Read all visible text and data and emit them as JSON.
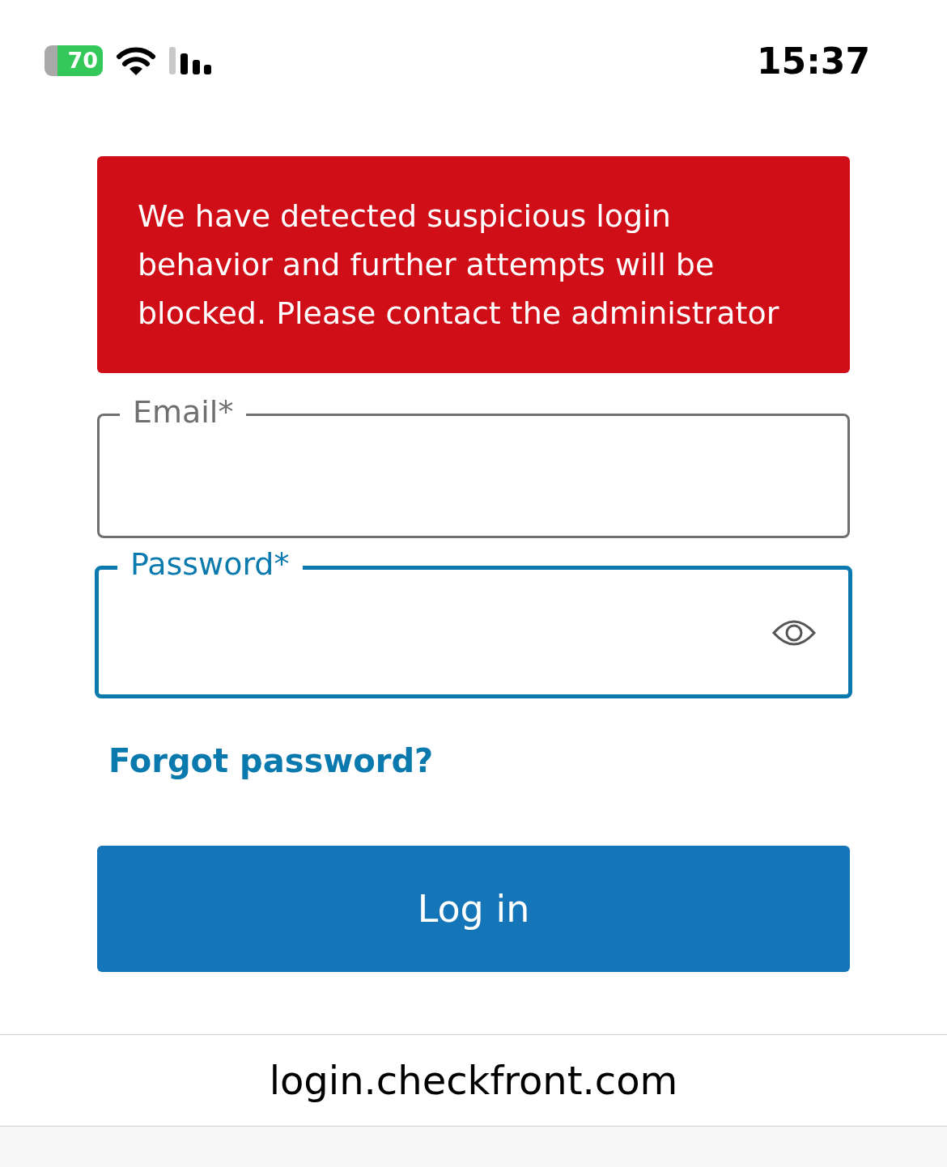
{
  "status_bar": {
    "battery": "70",
    "time": "15:37"
  },
  "alert": {
    "message": "We have detected suspicious login behavior and further attempts will be blocked. Please contact the administrator"
  },
  "fields": [
    {
      "label": "Email*",
      "focused": false,
      "kind": "text"
    },
    {
      "label": "Password*",
      "focused": true,
      "kind": "password"
    }
  ],
  "forgot_link": "Forgot password?",
  "login_button": "Log in",
  "address_bar": {
    "url": "login.checkfront.com"
  }
}
